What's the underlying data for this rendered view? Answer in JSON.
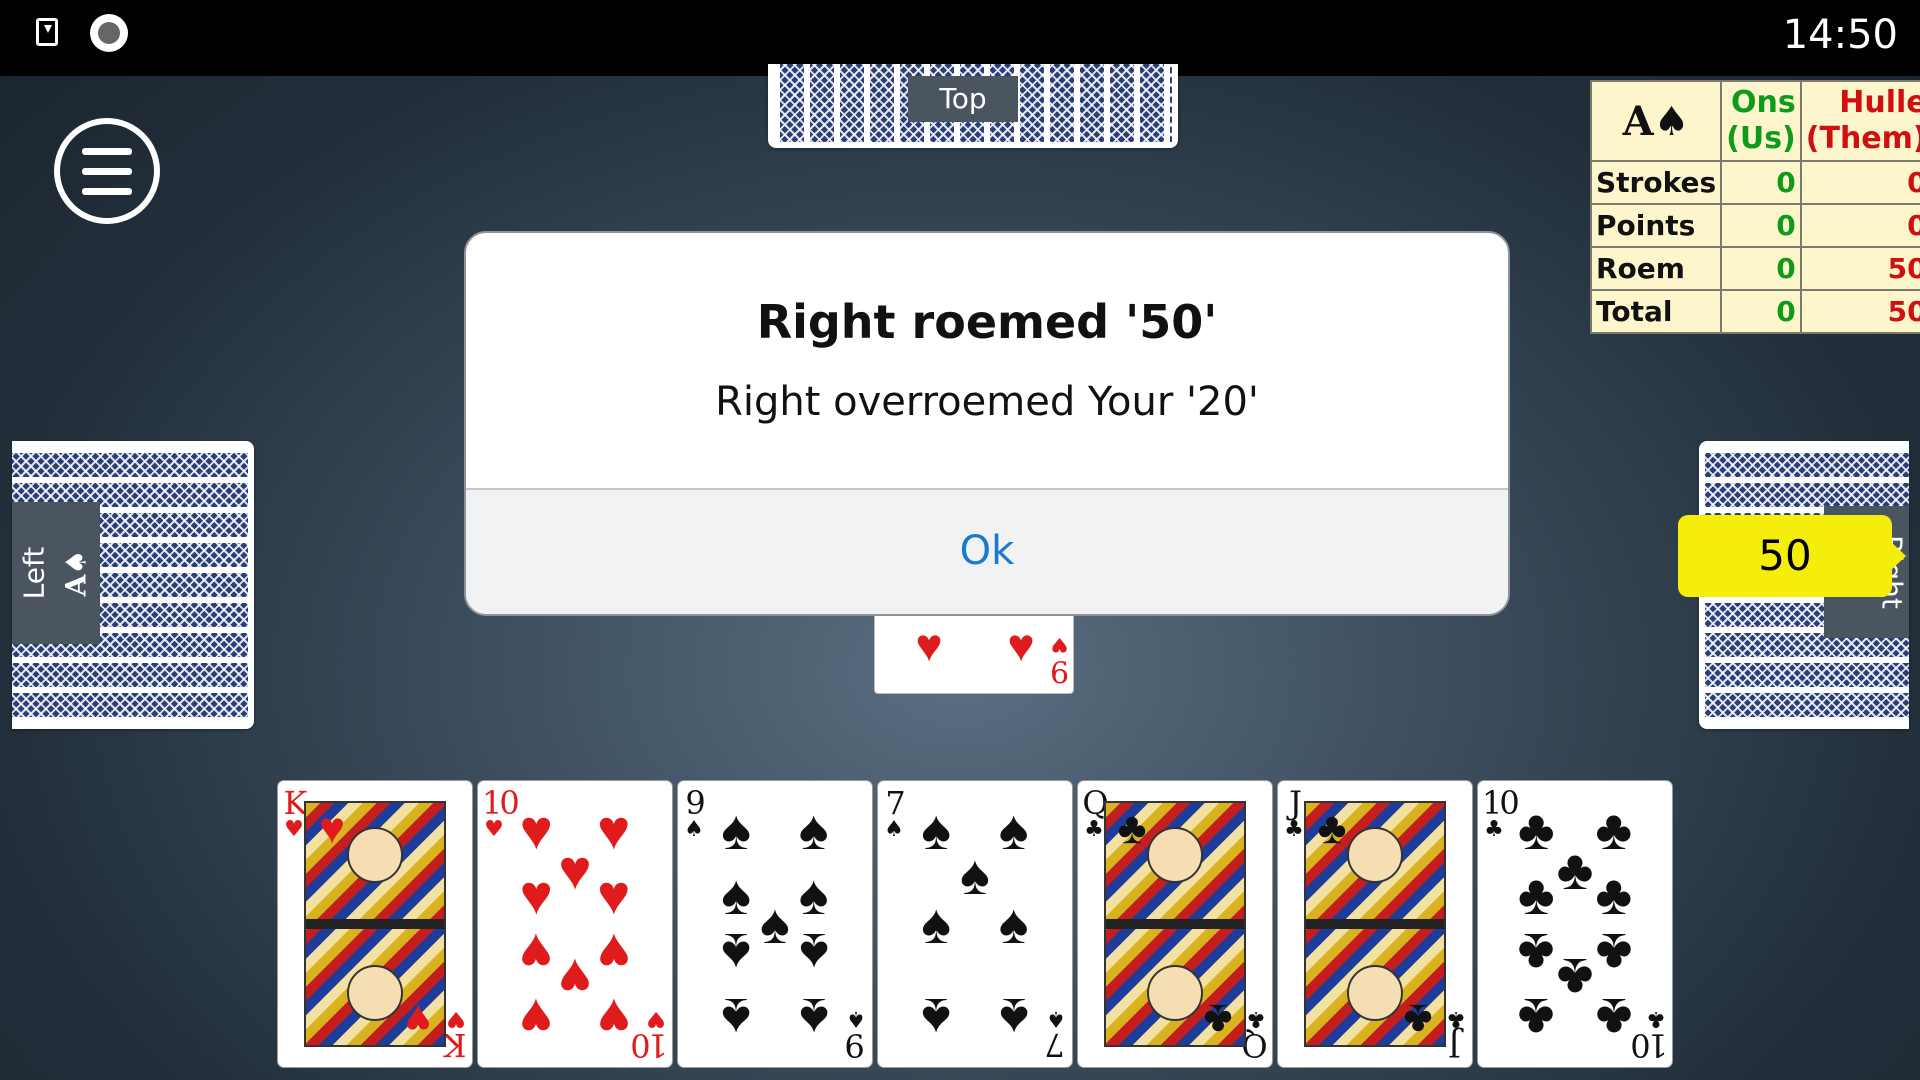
{
  "status_bar": {
    "clock": "14:50",
    "icons": [
      "download-icon",
      "record-icon"
    ]
  },
  "players": {
    "top": "Top",
    "left": "Left",
    "right": "Right"
  },
  "player_trump_marker": "A♠",
  "score_table": {
    "trump": "A♠",
    "us_header": [
      "Ons",
      "(Us)"
    ],
    "them_header": [
      "Hulle",
      "(Them)"
    ],
    "rows": [
      {
        "label": "Strokes",
        "us": "0",
        "them": "0"
      },
      {
        "label": "Points",
        "us": "0",
        "them": "0"
      },
      {
        "label": "Roem",
        "us": "0",
        "them": "50"
      },
      {
        "label": "Total",
        "us": "0",
        "them": "50"
      }
    ],
    "colors": {
      "us": "#0f9b1a",
      "them": "#d01010",
      "background": "#fdf6cc"
    }
  },
  "bid_bubble": "50",
  "played_card": {
    "rank": "9",
    "suit": "♥"
  },
  "dialog": {
    "title": "Right roemed '50'",
    "message": "Right overroemed Your '20'",
    "ok_label": "Ok"
  },
  "hand": [
    {
      "rank": "K",
      "suit": "♥",
      "color": "red",
      "type": "face"
    },
    {
      "rank": "10",
      "suit": "♥",
      "color": "red",
      "type": "pips"
    },
    {
      "rank": "9",
      "suit": "♠",
      "color": "black",
      "type": "pips"
    },
    {
      "rank": "7",
      "suit": "♠",
      "color": "black",
      "type": "pips"
    },
    {
      "rank": "Q",
      "suit": "♣",
      "color": "black",
      "type": "face"
    },
    {
      "rank": "J",
      "suit": "♣",
      "color": "black",
      "type": "face"
    },
    {
      "rank": "10",
      "suit": "♣",
      "color": "black",
      "type": "pips"
    }
  ]
}
